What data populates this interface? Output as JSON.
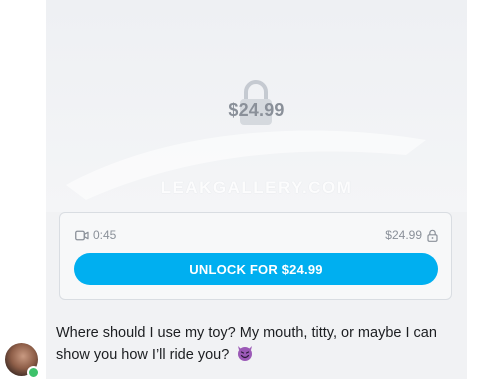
{
  "media": {
    "locked_price": "$24.99",
    "watermark": "LEAKGALLERY.COM"
  },
  "card": {
    "duration": "0:45",
    "price": "$24.99",
    "unlock_label": "UNLOCK FOR $24.99"
  },
  "message": {
    "text": "Where should I use my toy? My mouth, titty, or maybe I can show you how I’ll ride you?",
    "emoji": "smiling-face-with-horns"
  },
  "colors": {
    "accent": "#00aff0",
    "online": "#3ec26b"
  }
}
